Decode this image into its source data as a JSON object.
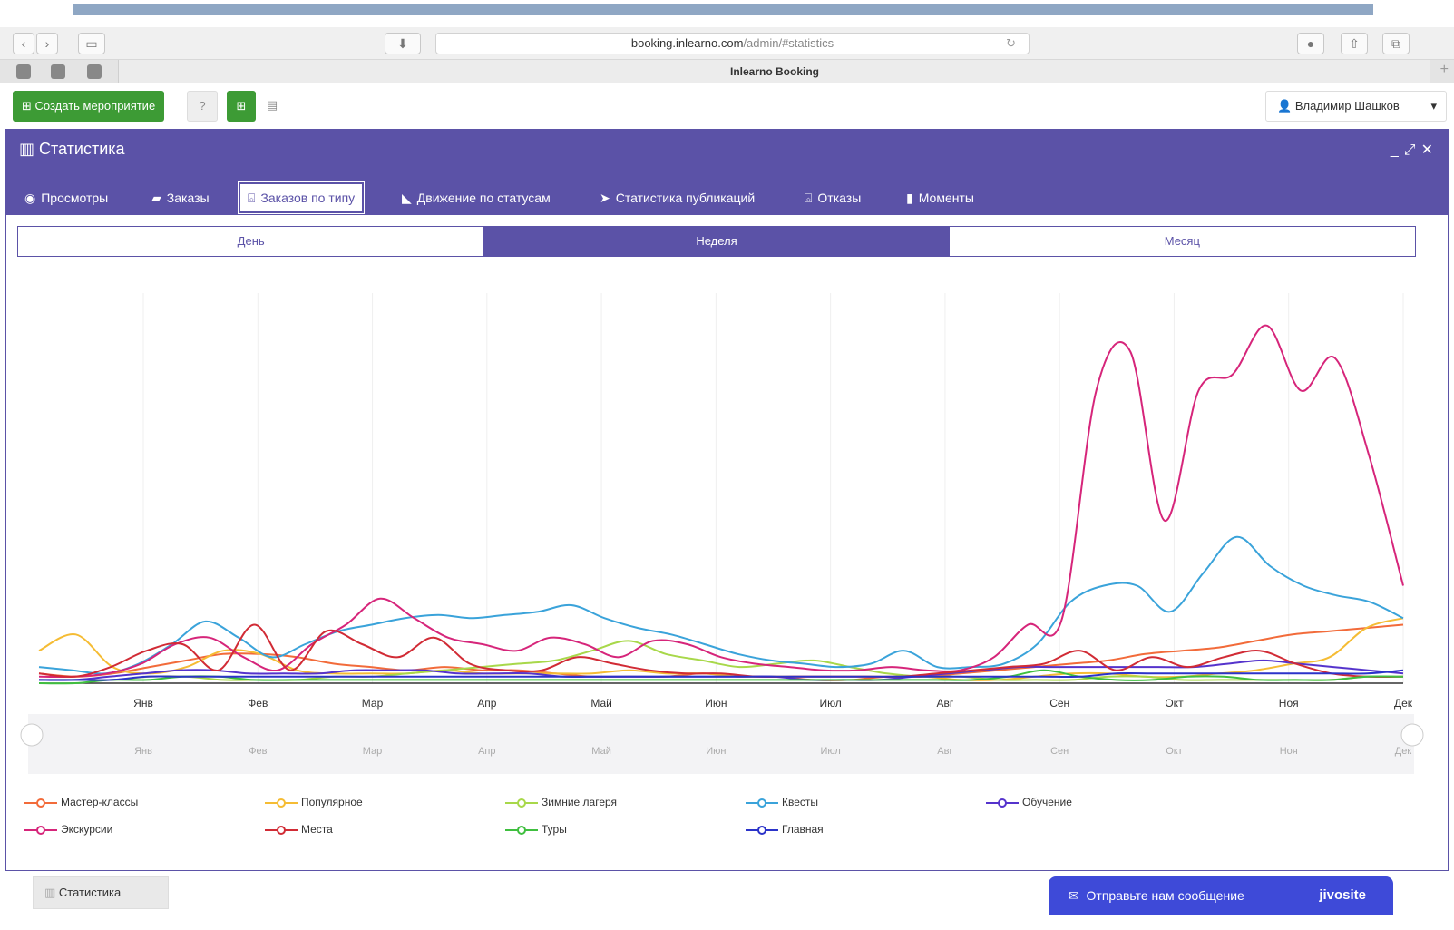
{
  "browser": {
    "url_host": "booking.inlearno.com",
    "url_path": "/admin/#statistics",
    "tab_title": "Inlearno Booking"
  },
  "toolbar": {
    "create_label": "Создать мероприятие",
    "user_name": "Владимир Шашков"
  },
  "panel": {
    "title": "Статистика",
    "tabs": [
      {
        "label": "Просмотры",
        "icon": "eye-icon"
      },
      {
        "label": "Заказы",
        "icon": "truck-icon"
      },
      {
        "label": "Заказов по типу",
        "icon": "basket-icon",
        "active": true
      },
      {
        "label": "Движение по статусам",
        "icon": "area-chart-icon"
      },
      {
        "label": "Статистика публикаций",
        "icon": "paper-plane-icon"
      },
      {
        "label": "Отказы",
        "icon": "basket-icon"
      },
      {
        "label": "Моменты",
        "icon": "bookmark-icon"
      }
    ],
    "periods": [
      {
        "label": "День"
      },
      {
        "label": "Неделя",
        "selected": true
      },
      {
        "label": "Месяц"
      }
    ]
  },
  "chart_data": {
    "type": "line",
    "x_ticks": [
      "Янв",
      "Фев",
      "Мар",
      "Апр",
      "Май",
      "Июн",
      "Июл",
      "Авг",
      "Сен",
      "Окт",
      "Ноя",
      "Дек"
    ],
    "navigator_ticks": [
      "Янв",
      "Фев",
      "Мар",
      "Апр",
      "Май",
      "Июн",
      "Июл",
      "Авг",
      "Сен",
      "Окт",
      "Ноя",
      "Дек"
    ],
    "grid": true,
    "legend_position": "bottom",
    "series": [
      {
        "name": "Мастер-классы",
        "color": "#f26b3a",
        "values": [
          3,
          2,
          3,
          5,
          7,
          9,
          9,
          8,
          6,
          5,
          4,
          5,
          4,
          4,
          3,
          2,
          2,
          2,
          3,
          2,
          2,
          1,
          1,
          2,
          2,
          3,
          4,
          5,
          6,
          7,
          9,
          10,
          11,
          13,
          15,
          16,
          17,
          18
        ]
      },
      {
        "name": "Популярное",
        "color": "#f5bc34",
        "values": [
          10,
          15,
          5,
          3,
          5,
          10,
          9,
          4,
          3,
          3,
          3,
          4,
          3,
          3,
          3,
          3,
          4,
          3,
          3,
          2,
          2,
          2,
          2,
          2,
          2,
          1,
          1,
          2,
          3,
          3,
          2,
          2,
          3,
          4,
          6,
          8,
          17,
          20
        ]
      },
      {
        "name": "Зимние лагеря",
        "color": "#a8d84a",
        "values": [
          1,
          1,
          1,
          2,
          2,
          1,
          1,
          1,
          2,
          2,
          3,
          4,
          5,
          6,
          7,
          10,
          13,
          9,
          7,
          5,
          6,
          7,
          5,
          3,
          2,
          2,
          1,
          1,
          1,
          2,
          2,
          1,
          1,
          1,
          1,
          1,
          2,
          2
        ]
      },
      {
        "name": "Квесты",
        "color": "#3aa3da",
        "values": [
          5,
          4,
          3,
          6,
          12,
          19,
          14,
          8,
          12,
          16,
          18,
          20,
          21,
          20,
          21,
          22,
          24,
          20,
          17,
          15,
          12,
          9,
          7,
          6,
          5,
          6,
          10,
          5,
          5,
          6,
          12,
          25,
          30,
          30,
          22,
          34,
          45,
          36,
          30,
          27,
          25,
          20
        ]
      },
      {
        "name": "Обучение",
        "color": "#5533cc",
        "values": [
          1,
          1,
          2,
          3,
          4,
          4,
          3,
          3,
          3,
          4,
          4,
          4,
          3,
          3,
          3,
          2,
          2,
          2,
          2,
          2,
          2,
          2,
          1,
          1,
          1,
          2,
          3,
          4,
          5,
          5,
          5,
          5,
          5,
          5,
          6,
          7,
          6,
          5,
          4,
          3
        ]
      },
      {
        "name": "Экскурсии",
        "color": "#d6257a",
        "values": [
          2,
          2,
          3,
          6,
          12,
          14,
          8,
          4,
          12,
          18,
          26,
          20,
          14,
          12,
          10,
          14,
          12,
          8,
          13,
          12,
          8,
          6,
          5,
          4,
          4,
          5,
          4,
          4,
          8,
          18,
          20,
          90,
          102,
          50,
          90,
          95,
          110,
          90,
          100,
          70,
          30
        ]
      },
      {
        "name": "Места",
        "color": "#d12b35",
        "values": [
          3,
          2,
          5,
          10,
          12,
          4,
          18,
          4,
          16,
          12,
          8,
          14,
          6,
          4,
          4,
          8,
          6,
          4,
          3,
          3,
          2,
          2,
          2,
          2,
          2,
          3,
          4,
          5,
          6,
          10,
          4,
          8,
          5,
          8,
          10,
          6,
          3,
          2,
          2
        ]
      },
      {
        "name": "Туры",
        "color": "#3fbf3f",
        "values": [
          0,
          0,
          1,
          1,
          2,
          2,
          1,
          1,
          1,
          1,
          1,
          1,
          1,
          1,
          1,
          1,
          1,
          1,
          1,
          1,
          1,
          1,
          1,
          1,
          1,
          1,
          1,
          2,
          4,
          2,
          1,
          1,
          2,
          2,
          1,
          1,
          1,
          2,
          2
        ]
      },
      {
        "name": "Главная",
        "color": "#2b33c9",
        "values": [
          1,
          1,
          1,
          2,
          2,
          2,
          2,
          2,
          2,
          2,
          2,
          2,
          2,
          2,
          2,
          2,
          2,
          2,
          2,
          2,
          2,
          2,
          2,
          2,
          2,
          2,
          2,
          2,
          2,
          2,
          3,
          3,
          3,
          3,
          3,
          3,
          3,
          3,
          4
        ]
      }
    ]
  },
  "footer": {
    "task_label": "Статистика",
    "jivo_label": "Отправьте нам сообщение",
    "jivo_brand": "jivosite"
  }
}
